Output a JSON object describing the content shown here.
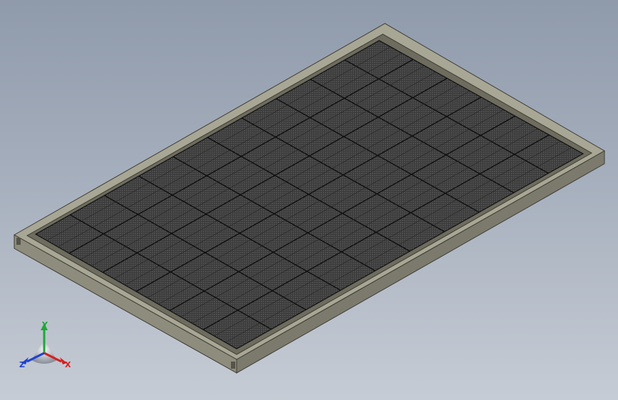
{
  "viewport": {
    "background_top": "#8f9aab",
    "background_bottom": "#c6ccd5"
  },
  "model": {
    "name": "solar-panel",
    "frame_color": "#a5a392",
    "frame_shadow": "#6e6c5e",
    "cell_color": "#3e3e3e",
    "grid_line_color": "#111111",
    "cell_rows": 6,
    "cell_columns": 10
  },
  "triad": {
    "x_label": "X",
    "y_label": "Y",
    "z_label": "Z",
    "x_color": "#d42020",
    "y_color": "#1fa83a",
    "z_color": "#2040d0"
  }
}
